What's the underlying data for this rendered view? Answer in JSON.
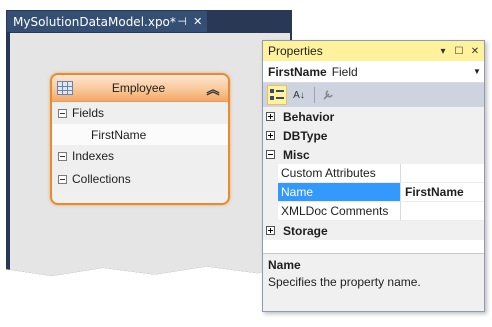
{
  "document": {
    "tab_title": "MySolutionDataModel.xpo*",
    "pin_glyph": "⊣",
    "close_glyph": "✕"
  },
  "entity": {
    "title": "Employee",
    "collapse_glyph": "︽",
    "sections": {
      "fields": "Fields",
      "indexes": "Indexes",
      "collections": "Collections"
    },
    "fields": [
      "FirstName"
    ]
  },
  "properties": {
    "title": "Properties",
    "title_buttons": [
      "▾",
      "☐",
      "✕"
    ],
    "object_name": "FirstName",
    "object_type": "Field",
    "object_dropdown_glyph": "▼",
    "toolbar": {
      "categorized_icon": "categorized-icon",
      "alphabetical_glyph": "A↓",
      "property_pages_glyph": "🔧"
    },
    "categories": {
      "behavior": "Behavior",
      "dbtype": "DBType",
      "misc": "Misc",
      "storage": "Storage"
    },
    "misc_rows": [
      {
        "name": "Custom Attributes",
        "value": ""
      },
      {
        "name": "Name",
        "value": "FirstName"
      },
      {
        "name": "XMLDoc Comments",
        "value": ""
      }
    ],
    "description": {
      "title": "Name",
      "text": "Specifies the property name."
    }
  },
  "colors": {
    "doc_border": "#293955",
    "properties_title_bg": "#fff29d",
    "entity_border": "#e88a2e",
    "selection": "#3399ff"
  }
}
